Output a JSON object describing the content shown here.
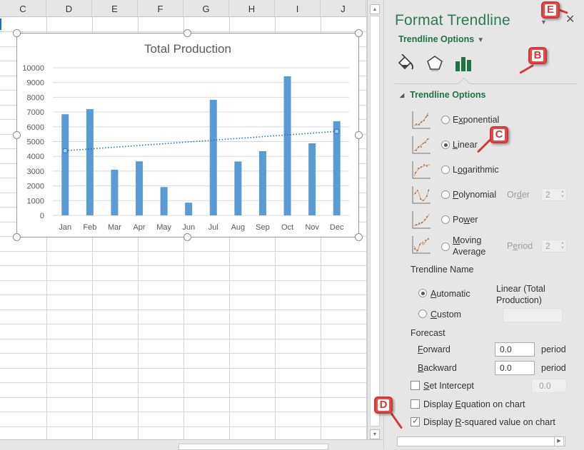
{
  "spreadsheet": {
    "columns": [
      "C",
      "D",
      "E",
      "F",
      "G",
      "H",
      "I",
      "J"
    ]
  },
  "chart_data": {
    "type": "bar",
    "title": "Total Production",
    "categories": [
      "Jan",
      "Feb",
      "Mar",
      "Apr",
      "May",
      "Jun",
      "Jul",
      "Aug",
      "Sep",
      "Oct",
      "Nov",
      "Dec"
    ],
    "series": [
      {
        "name": "Total Production",
        "values": [
          6850,
          7200,
          3090,
          3660,
          1920,
          860,
          7830,
          3650,
          4350,
          9420,
          4880,
          6380
        ],
        "color": "#5b9bd5"
      }
    ],
    "trendline": {
      "type": "linear",
      "name": "Linear (Total Production)",
      "start": 4380,
      "end": 5690,
      "color": "#2e6fad",
      "style": "dotted"
    },
    "yticks": [
      0,
      1000,
      2000,
      3000,
      4000,
      5000,
      6000,
      7000,
      8000,
      9000,
      10000
    ],
    "ylim": [
      0,
      10000
    ],
    "xlabel": "",
    "ylabel": "",
    "grid": true,
    "legend": "none"
  },
  "panel": {
    "title": "Format Trendline",
    "options_menu": "Trendline Options",
    "section_title": "Trendline Options",
    "tabs": [
      {
        "name": "fill-line",
        "icon": "paint-bucket-icon"
      },
      {
        "name": "effects",
        "icon": "pentagon-icon"
      },
      {
        "name": "trendline-options",
        "icon": "bar-chart-icon",
        "active": true
      }
    ],
    "trend_types": [
      {
        "label": "Exponential",
        "selected": false
      },
      {
        "label": "Linear",
        "selected": true
      },
      {
        "label": "Logarithmic",
        "selected": false
      },
      {
        "label": "Polynomial",
        "selected": false,
        "param_label": "Order",
        "param_value": "2"
      },
      {
        "label": "Power",
        "selected": false
      },
      {
        "label": "Moving",
        "label2": "Average",
        "selected": false,
        "param_label": "Period",
        "param_value": "2"
      }
    ],
    "trendline_name": {
      "heading": "Trendline Name",
      "automatic_label": "Automatic",
      "automatic_value_line1": "Linear (Total",
      "automatic_value_line2": "Production)",
      "custom_label": "Custom",
      "custom_value": "",
      "selected": "automatic"
    },
    "forecast": {
      "heading": "Forecast",
      "forward_label": "Forward",
      "forward_value": "0.0",
      "backward_label": "Backward",
      "backward_value": "0.0",
      "unit": "periods"
    },
    "set_intercept": {
      "label": "Set Intercept",
      "checked": false,
      "value": "0.0"
    },
    "display_equation": {
      "label": "Display Equation on chart",
      "checked": false
    },
    "display_rsquared": {
      "label": "Display R-squared value on chart",
      "checked": true
    }
  },
  "callouts": [
    "B",
    "C",
    "D",
    "E"
  ],
  "colors": {
    "accent": "#217346",
    "bar": "#5b9bd5",
    "callout": "#e84a4a"
  }
}
